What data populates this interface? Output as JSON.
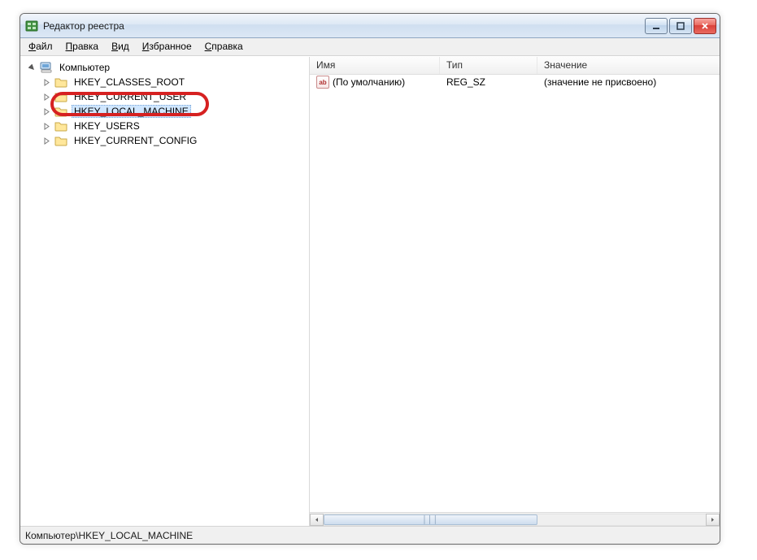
{
  "window": {
    "title": "Редактор реестра"
  },
  "menu": {
    "file": {
      "pre": "",
      "ul": "Ф",
      "post": "айл"
    },
    "edit": {
      "pre": "",
      "ul": "П",
      "post": "равка"
    },
    "view": {
      "pre": "",
      "ul": "В",
      "post": "ид"
    },
    "fav": {
      "pre": "",
      "ul": "И",
      "post": "збранное"
    },
    "help": {
      "pre": "",
      "ul": "С",
      "post": "правка"
    }
  },
  "tree": {
    "root": "Компьютер",
    "items": [
      {
        "label": "HKEY_CLASSES_ROOT",
        "selected": false
      },
      {
        "label": "HKEY_CURRENT_USER",
        "selected": false
      },
      {
        "label": "HKEY_LOCAL_MACHINE",
        "selected": true
      },
      {
        "label": "HKEY_USERS",
        "selected": false
      },
      {
        "label": "HKEY_CURRENT_CONFIG",
        "selected": false
      }
    ]
  },
  "list": {
    "headers": {
      "name": "Имя",
      "type": "Тип",
      "value": "Значение"
    },
    "rows": [
      {
        "icon_text": "ab",
        "name": "(По умолчанию)",
        "type": "REG_SZ",
        "value": "(значение не присвоено)"
      }
    ]
  },
  "statusbar": {
    "path": "Компьютер\\HKEY_LOCAL_MACHINE"
  }
}
